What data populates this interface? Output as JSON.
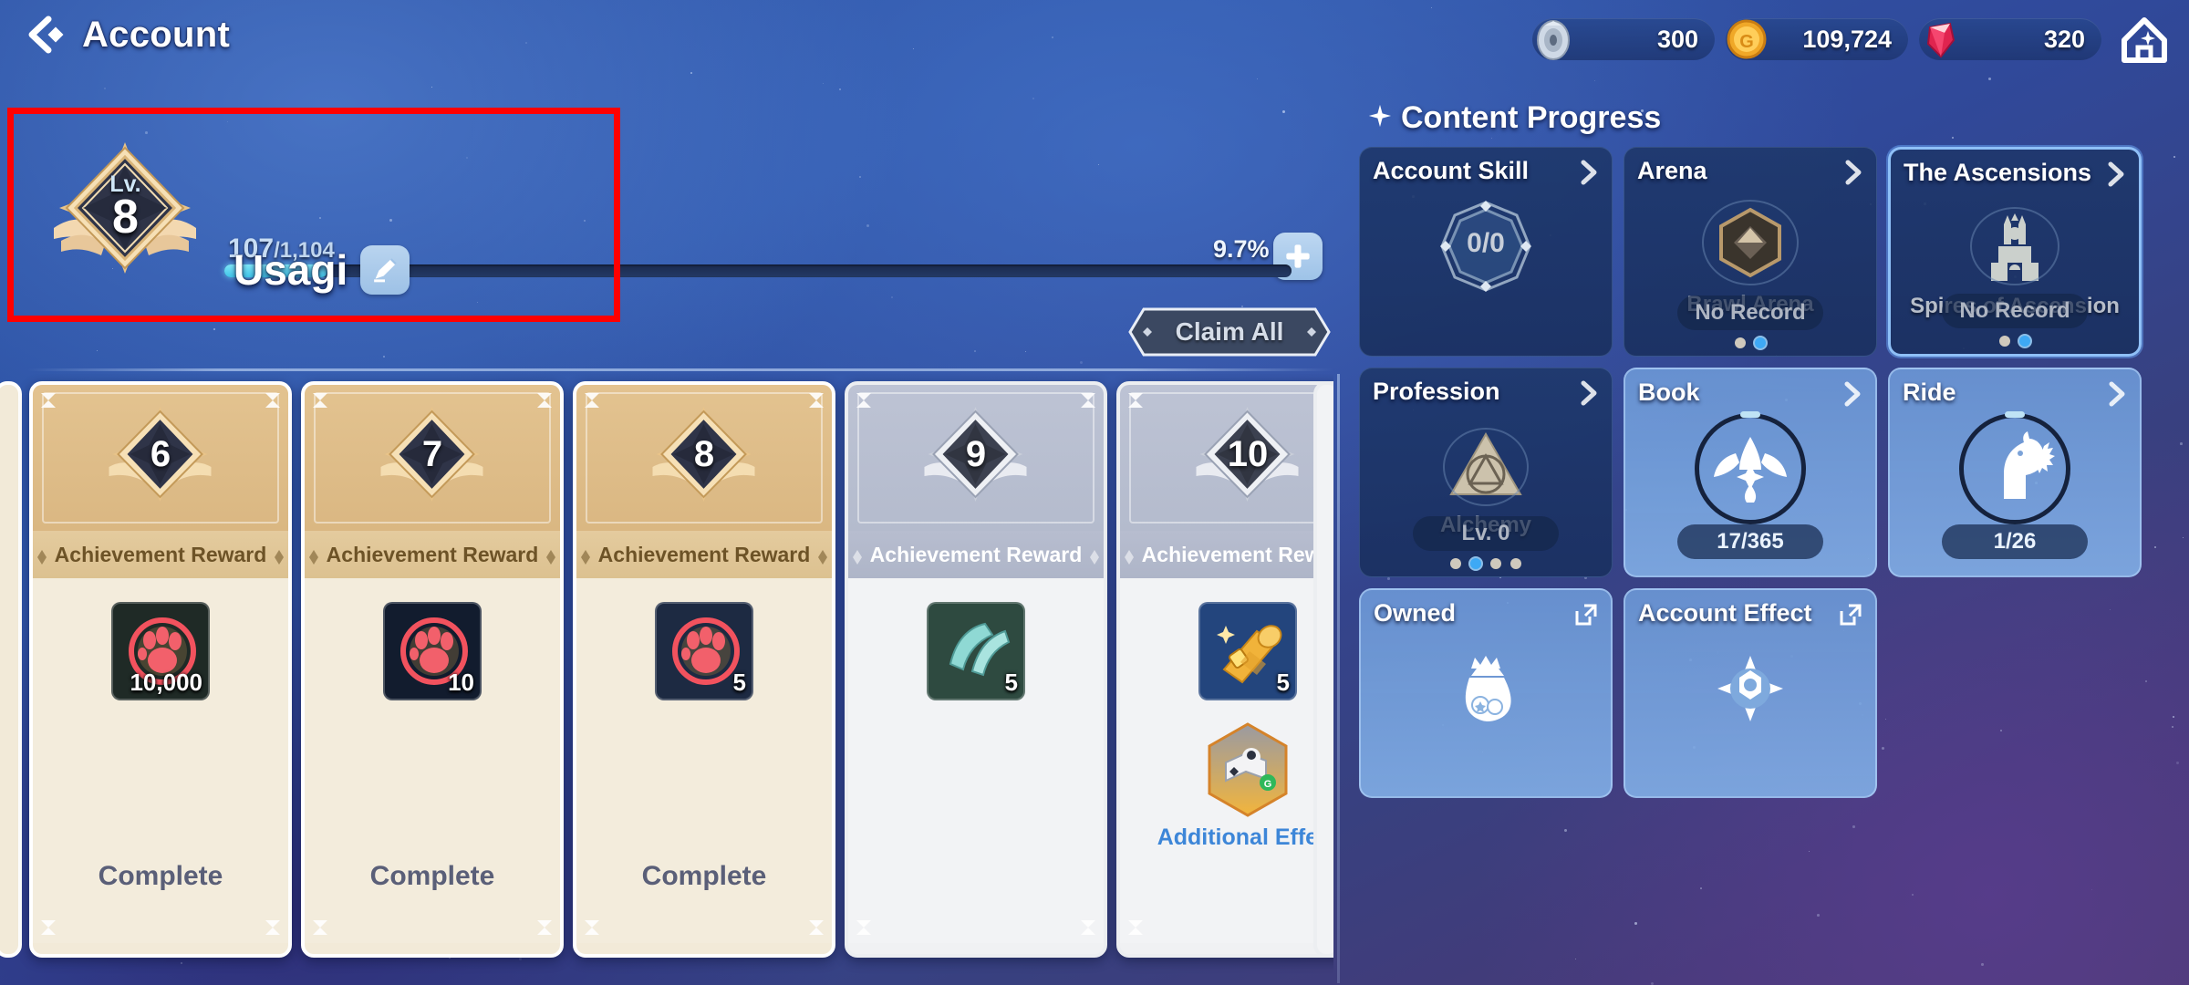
{
  "header": {
    "back_icon": "back-arrow-icon",
    "title": "Account",
    "home_icon": "home-icon",
    "currencies": [
      {
        "icon": "silver-shell-icon",
        "value": "300"
      },
      {
        "icon": "gold-coin-icon",
        "value": "109,724"
      },
      {
        "icon": "red-gem-icon",
        "value": "320"
      }
    ]
  },
  "profile": {
    "level_label": "Lv.",
    "level_value": "8",
    "name": "Usagi",
    "edit_icon": "pencil-edit-icon",
    "xp_current": "107",
    "xp_separator": "/",
    "xp_max": "1,104",
    "xp_percent": "9.7%",
    "xp_fill_ratio": 0.097,
    "add_icon": "plus-icon",
    "claim_all_label": "Claim All",
    "highlight_color": "#ff0000"
  },
  "achievement_cards": [
    {
      "rank": "6",
      "label": "Achievement Reward",
      "status": "Complete",
      "locked": false,
      "item": {
        "icon": "red-paw-token-icon",
        "count": "10,000",
        "rarity_color": "#1f2a26"
      },
      "extra": null
    },
    {
      "rank": "7",
      "label": "Achievement Reward",
      "status": "Complete",
      "locked": false,
      "item": {
        "icon": "red-paw-token-icon",
        "count": "10",
        "rarity_color": "#121c2e"
      },
      "extra": null
    },
    {
      "rank": "8",
      "label": "Achievement Reward",
      "status": "Complete",
      "locked": false,
      "item": {
        "icon": "red-paw-token-icon",
        "count": "5",
        "rarity_color": "#1d2a42"
      },
      "extra": null
    },
    {
      "rank": "9",
      "label": "Achievement Reward",
      "status": "",
      "locked": true,
      "item": {
        "icon": "teal-cloth-scrap-icon",
        "count": "5",
        "rarity_color": "#2e4a40"
      },
      "extra": null
    },
    {
      "rank": "10",
      "label": "Achievement Reward",
      "status": "",
      "locked": true,
      "item": {
        "icon": "gold-scroll-icon",
        "count": "5",
        "rarity_color": "#23457d"
      },
      "extra": {
        "icon": "map-marker-hex-icon",
        "label": "Additional Effect",
        "label_color": "#3d86d8"
      }
    }
  ],
  "content_progress": {
    "title": "Content Progress",
    "sparkle_icon": "sparkle-icon",
    "cards": [
      {
        "title": "Account Skill",
        "icon": "eight-point-star-icon",
        "center_value": "0/0",
        "subtitle": "",
        "pill": "",
        "dots": [],
        "style": "dim",
        "action_icon": "chevron-right-icon"
      },
      {
        "title": "Arena",
        "icon": "hexagon-crest-icon",
        "center_value": "",
        "subtitle": "Brawl Arena",
        "pill": "No Record",
        "dots": [
          false,
          true
        ],
        "style": "dim",
        "action_icon": "chevron-right-icon"
      },
      {
        "title": "The Ascensions",
        "icon": "spire-tower-icon",
        "center_value": "",
        "subtitle": "Spires of Ascension",
        "pill": "No Record",
        "dots": [
          false,
          true
        ],
        "style": "selected",
        "action_icon": "chevron-right-icon"
      },
      {
        "title": "Profession",
        "icon": "alchemy-triangle-icon",
        "center_value": "",
        "subtitle": "Alchemy",
        "pill": "Lv. 0",
        "dots": [
          false,
          true,
          false,
          false
        ],
        "style": "dim",
        "action_icon": "chevron-right-icon"
      },
      {
        "title": "Book",
        "icon": "winged-book-icon",
        "center_value": "",
        "subtitle": "",
        "pill": "17/365",
        "dots": [],
        "style": "bright",
        "action_icon": "chevron-right-icon"
      },
      {
        "title": "Ride",
        "icon": "horse-head-icon",
        "center_value": "",
        "subtitle": "",
        "pill": "1/26",
        "dots": [],
        "style": "bright",
        "action_icon": "chevron-right-icon"
      },
      {
        "title": "Owned",
        "icon": "money-bag-icon",
        "center_value": "",
        "subtitle": "",
        "pill": "",
        "dots": [],
        "style": "bright",
        "action_icon": "external-link-icon"
      },
      {
        "title": "Account Effect",
        "icon": "compass-rose-icon",
        "center_value": "",
        "subtitle": "",
        "pill": "",
        "dots": [],
        "style": "bright",
        "action_icon": "external-link-icon"
      }
    ]
  }
}
